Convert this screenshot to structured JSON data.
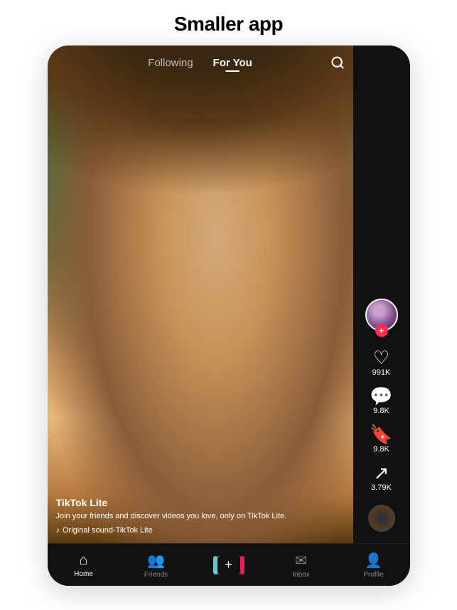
{
  "page": {
    "title": "Smaller app"
  },
  "header": {
    "following_label": "Following",
    "for_you_label": "For You",
    "active_tab": "For You"
  },
  "video": {
    "username": "TikTok Lite",
    "description": "Join your friends and discover videos you love, only on TikTok Lite.",
    "sound": "Original sound-TikTok Lite"
  },
  "actions": {
    "likes": "991K",
    "comments": "9.8K",
    "bookmarks": "9.8K",
    "shares": "3.79K"
  },
  "bottom_nav": {
    "home": "Home",
    "friends": "Friends",
    "inbox": "Inbox",
    "profile": "Profile"
  }
}
